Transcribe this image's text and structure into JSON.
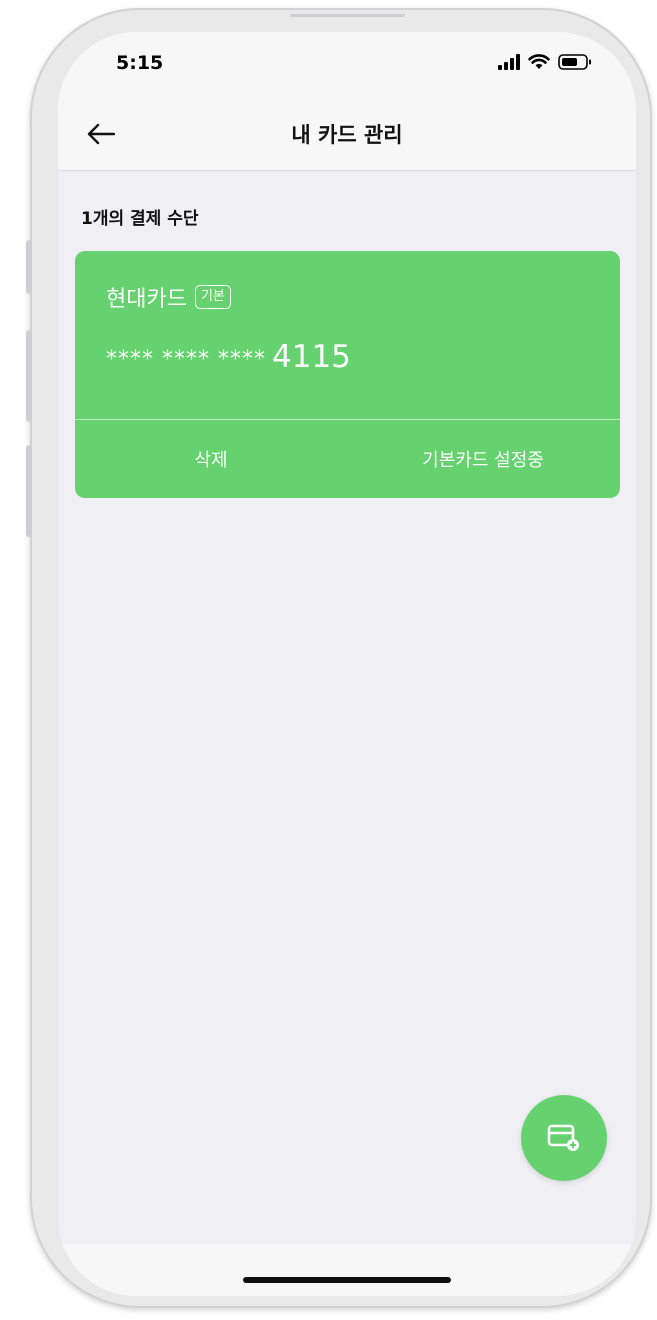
{
  "status": {
    "time": "5:15",
    "icons": [
      "signal-icon",
      "wifi-icon",
      "battery-icon"
    ]
  },
  "nav": {
    "back_icon": "back-arrow-icon",
    "title": "내 카드 관리"
  },
  "section": {
    "title": "1개의 결제 수단"
  },
  "cards": [
    {
      "name": "현대카드",
      "badge": "기본",
      "masked_number": "**** **** ****",
      "last4": "4115",
      "delete_label": "삭제",
      "default_status_label": "기본카드 설정중"
    }
  ],
  "fab": {
    "icon": "add-card-icon"
  },
  "colors": {
    "accent": "#65d26f",
    "background": "#efeff4",
    "bar": "#f7f7f7"
  }
}
